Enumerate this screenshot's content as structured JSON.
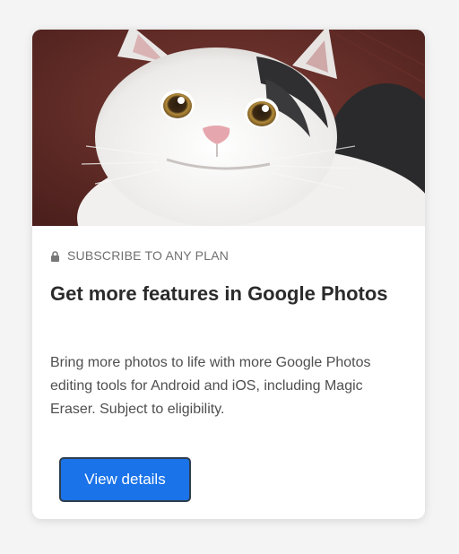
{
  "card": {
    "eyebrow": "SUBSCRIBE TO ANY PLAN",
    "eyebrow_icon": "lock-icon",
    "title": "Get more features in Google Photos",
    "description": "Bring more photos to life with more Google Photos editing tools for Android and iOS, including Magic Eraser. Subject to eligibility.",
    "button_label": "View details"
  },
  "colors": {
    "page_background": "#f4f4f4",
    "card_background": "#ffffff",
    "button": "#1a73e8",
    "title_text": "#2b2b2b",
    "body_text": "#4f4f4f"
  }
}
